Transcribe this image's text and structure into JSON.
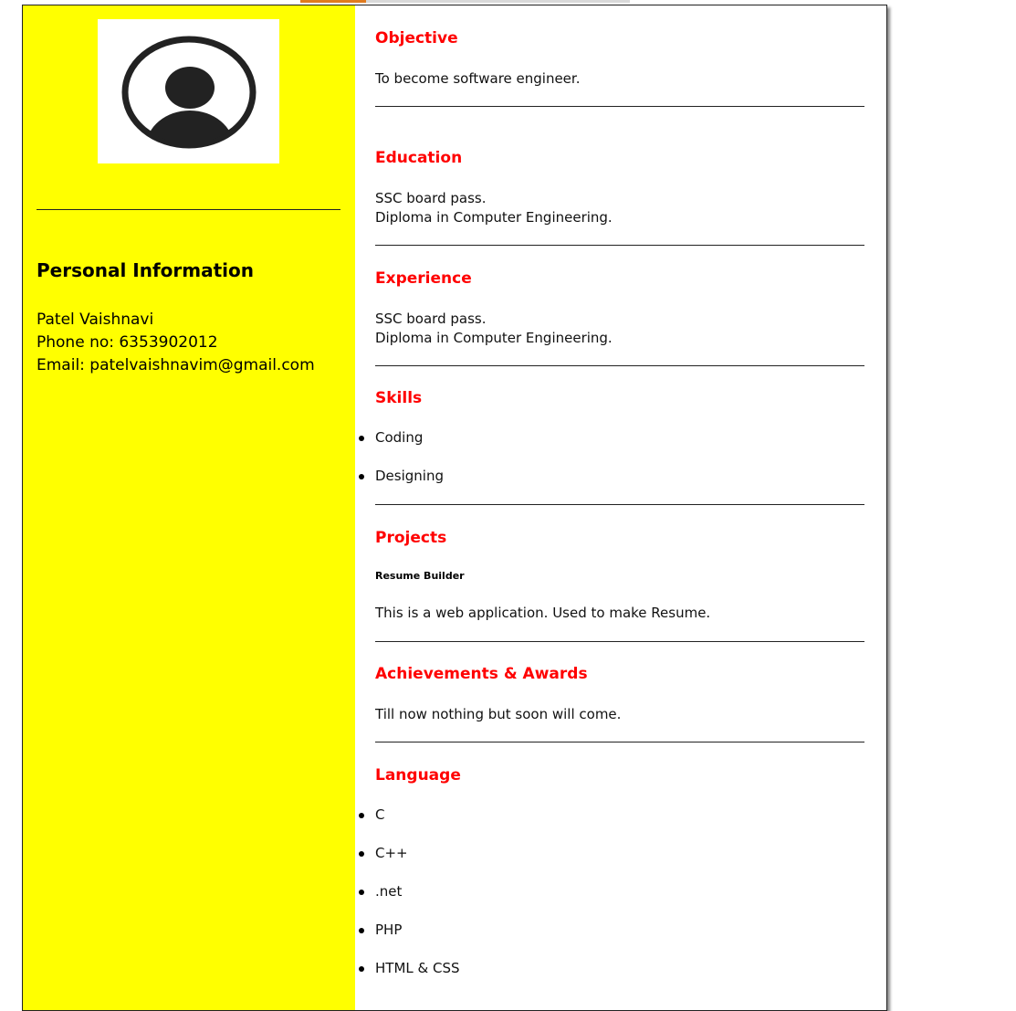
{
  "personal": {
    "heading": "Personal Information",
    "name": "Patel Vaishnavi",
    "phone": "Phone no: 6353902012",
    "email": "Email: patelvaishnavim@gmail.com",
    "photo_icon": "user-avatar-icon"
  },
  "objective": {
    "title": "Objective",
    "text": "To become software engineer."
  },
  "education": {
    "title": "Education",
    "lines": [
      "SSC board pass.",
      "Diploma in Computer Engineering."
    ]
  },
  "experience": {
    "title": "Experience",
    "lines": [
      "SSC board pass.",
      "Diploma in Computer Engineering."
    ]
  },
  "skills": {
    "title": "Skills",
    "items": [
      "Coding",
      "Designing"
    ]
  },
  "projects": {
    "title": "Projects",
    "name": "Resume Builder",
    "description": "This is a web application. Used to make Resume."
  },
  "achievements": {
    "title": "Achievements & Awards",
    "text": "Till now nothing but soon will come."
  },
  "language": {
    "title": "Language",
    "items": [
      "C",
      "C++",
      ".net",
      "PHP",
      "HTML & CSS"
    ]
  },
  "colors": {
    "sidebar": "#ffff00",
    "heading_accent": "#ff0000"
  }
}
